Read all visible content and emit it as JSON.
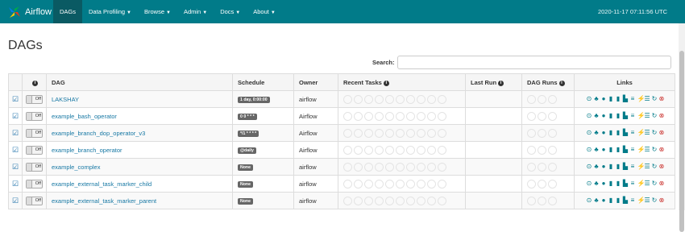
{
  "brand": {
    "name": "Airflow"
  },
  "nav": [
    {
      "label": "DAGs",
      "active": true,
      "caret": false
    },
    {
      "label": "Data Profiling",
      "caret": true
    },
    {
      "label": "Browse",
      "caret": true
    },
    {
      "label": "Admin",
      "caret": true
    },
    {
      "label": "Docs",
      "caret": true
    },
    {
      "label": "About",
      "caret": true
    }
  ],
  "clock": "2020-11-17 07:11:56 UTC",
  "page_title": "DAGs",
  "search": {
    "label": "Search:",
    "value": "",
    "placeholder": ""
  },
  "columns": {
    "info": "i",
    "dag": "DAG",
    "schedule": "Schedule",
    "owner": "Owner",
    "recent_tasks": "Recent Tasks",
    "last_run": "Last Run",
    "dag_runs": "DAG Runs",
    "links": "Links"
  },
  "toggle_label": "Off",
  "rows": [
    {
      "dag": "LAKSHAY",
      "schedule": "1 day, 0:00:00",
      "owner": "airflow"
    },
    {
      "dag": "example_bash_operator",
      "schedule": "0 0 * * *",
      "owner": "Airflow"
    },
    {
      "dag": "example_branch_dop_operator_v3",
      "schedule": "*/1 * * * *",
      "owner": "Airflow"
    },
    {
      "dag": "example_branch_operator",
      "schedule": "@daily",
      "owner": "Airflow"
    },
    {
      "dag": "example_complex",
      "schedule": "None",
      "owner": "airflow"
    },
    {
      "dag": "example_external_task_marker_child",
      "schedule": "None",
      "owner": "airflow"
    },
    {
      "dag": "example_external_task_marker_parent",
      "schedule": "None",
      "owner": "airflow"
    }
  ],
  "link_icons": [
    "play-icon",
    "tree-icon",
    "graph-icon",
    "duration-icon",
    "tries-icon",
    "landing-icon",
    "gantt-icon",
    "code-icon",
    "logs-icon",
    "refresh-icon",
    "delete-icon"
  ],
  "colors": {
    "navbar": "#017b89",
    "link": "#1778a4",
    "badge": "#666666",
    "delete": "#c9302c"
  }
}
